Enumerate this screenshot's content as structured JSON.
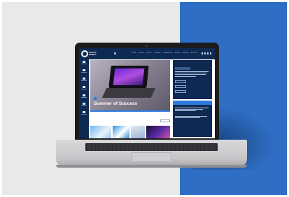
{
  "site": {
    "logo_text": "SUCCA\nFAMILY",
    "nav": [
      "HOME",
      "EVENTS",
      "VIDEOS",
      "COURSES",
      "COMMUNITIES",
      "ALUMNI",
      "INSIGHTS",
      "ARTICLES"
    ],
    "social": [
      "facebook-icon",
      "twitter-icon",
      "instagram-icon",
      "linkedin-icon"
    ]
  },
  "sidebar": {
    "items": [
      "home-icon",
      "community-icon",
      "send-icon",
      "money-icon",
      "tools-icon",
      "view-icon",
      "calendar-icon"
    ]
  },
  "hero": {
    "badge": "",
    "title": "Summer of Success"
  },
  "section": {
    "heading": "",
    "link": ""
  },
  "right_panel": {
    "heading": "",
    "pill": "",
    "buttons": [
      "",
      "",
      ""
    ]
  },
  "right_panel_2": {
    "heading": ""
  },
  "colors": {
    "navy": "#0f2a52",
    "accent_blue": "#2f7be0",
    "background_blue": "#2e6ec4",
    "background_grey": "#e9e9ea"
  }
}
